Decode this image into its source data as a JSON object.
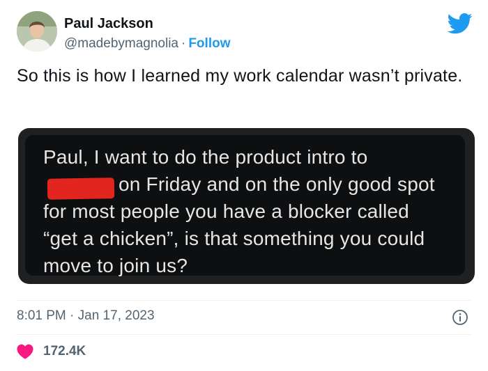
{
  "author": {
    "name": "Paul Jackson",
    "handle": "@madebymagnolia",
    "separator": "·",
    "follow_label": "Follow"
  },
  "tweet": {
    "text": "So this is how I learned my work calendar wasn’t private.",
    "timestamp": "8:01 PM · Jan 17, 2023",
    "likes": "172.4K"
  },
  "screenshot_message": {
    "line1": "Paul, I want to do the product intro to",
    "line2": "on Friday and on the only good spot",
    "line3": "for most people you have a blocker called",
    "line4": "“get a chicken”, is that something you could",
    "line5": "move to join us?"
  },
  "icons": {
    "platform": "twitter-bird-icon",
    "info": "info-icon",
    "like": "heart-icon"
  },
  "colors": {
    "accent": "#1d9bf0",
    "like": "#f91880",
    "redaction": "#e2261f",
    "secondary_text": "#536471"
  }
}
